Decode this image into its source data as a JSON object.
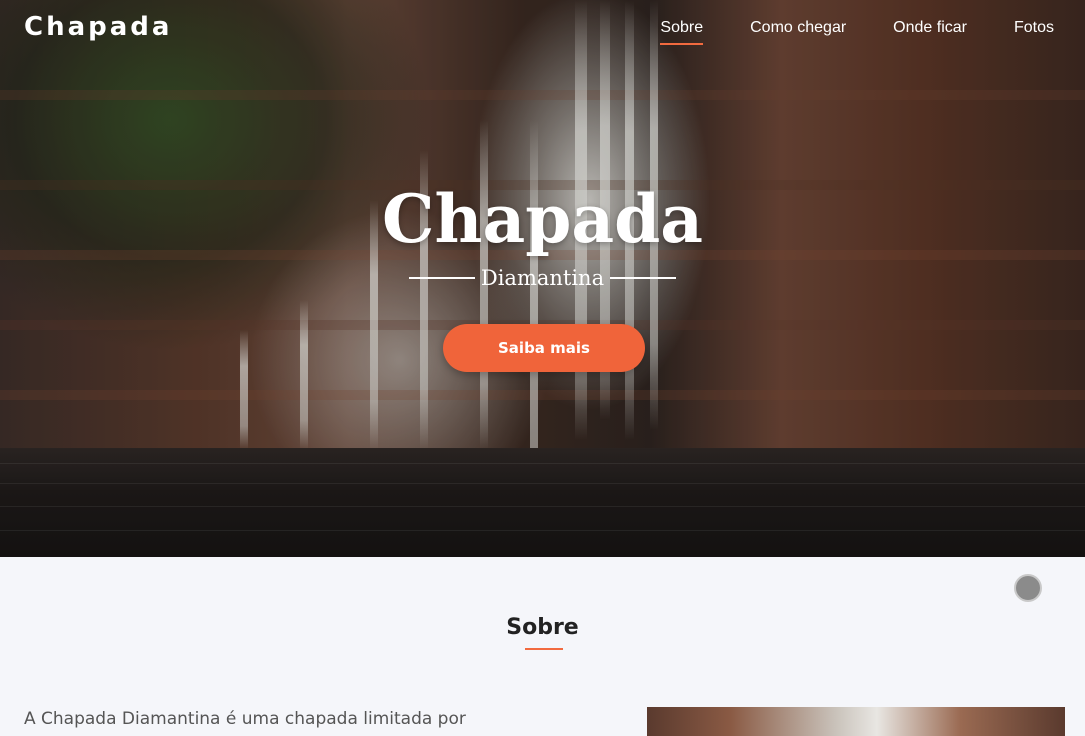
{
  "header": {
    "brand": "Chapada",
    "nav": [
      {
        "label": "Sobre",
        "active": true
      },
      {
        "label": "Como chegar",
        "active": false
      },
      {
        "label": "Onde ficar",
        "active": false
      },
      {
        "label": "Fotos",
        "active": false
      }
    ]
  },
  "hero": {
    "title": "Chapada",
    "subtitle": "Diamantina",
    "cta_label": "Saiba mais",
    "image": "waterfall-photo"
  },
  "about": {
    "title": "Sobre",
    "text": "A Chapada Diamantina é uma chapada limitada por",
    "image": "canyon-photo"
  },
  "colors": {
    "accent": "#f0643a",
    "background": "#f5f6fa",
    "text_dark": "#222222",
    "text_body": "#555555"
  }
}
